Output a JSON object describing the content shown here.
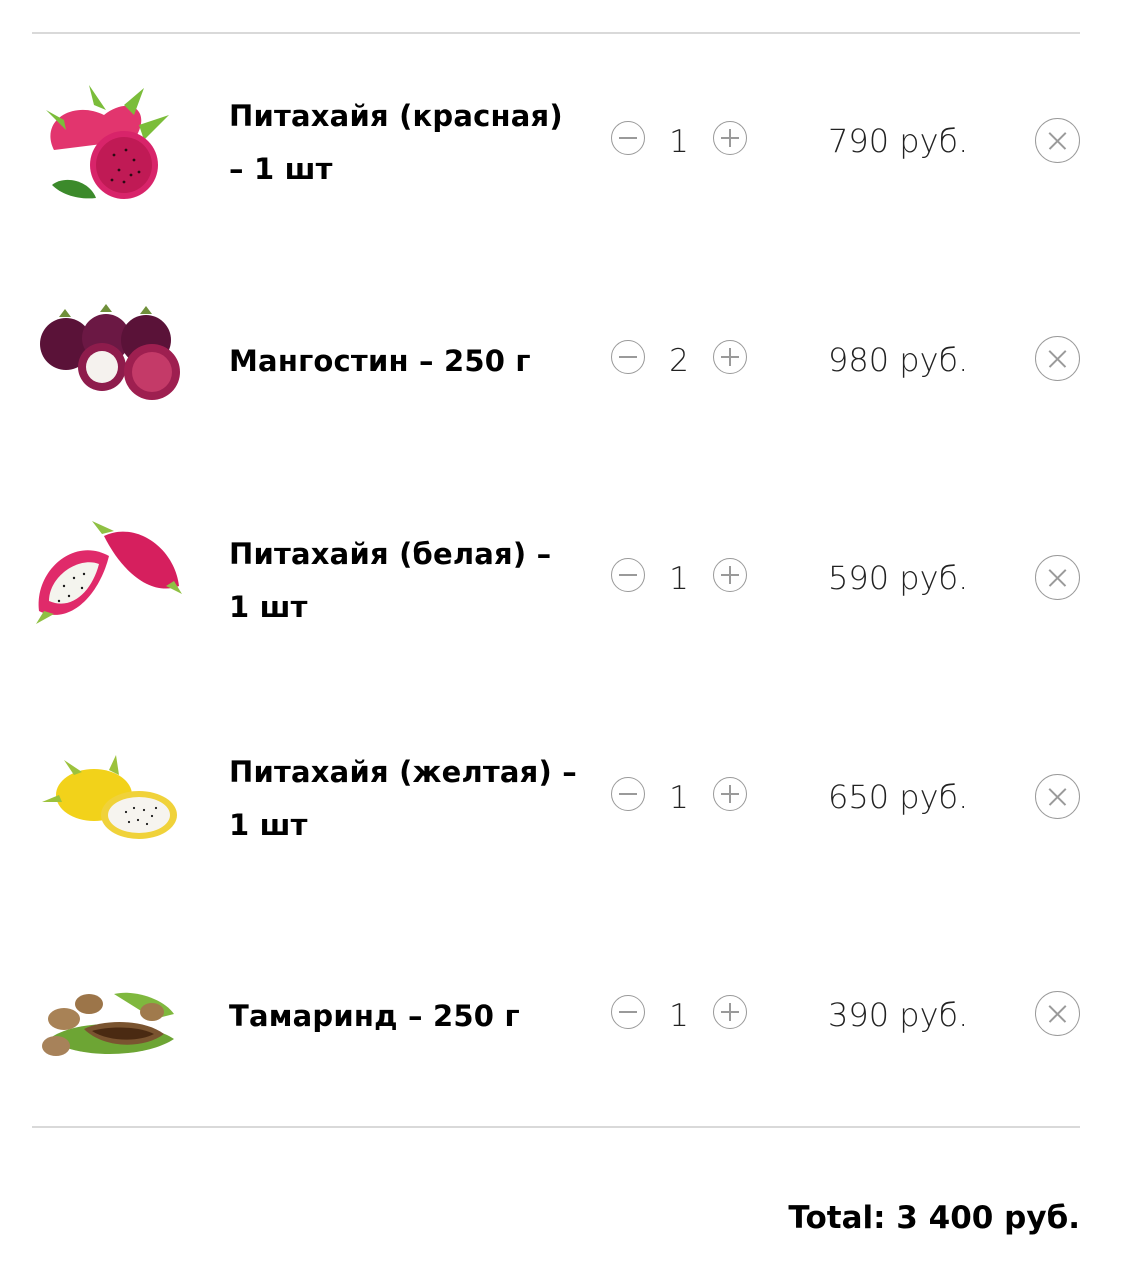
{
  "cart": {
    "items": [
      {
        "title": "Питахайя (красная) – 1 шт",
        "quantity": "1",
        "price": "790 руб.",
        "image": "red-dragon-fruit"
      },
      {
        "title": "Мангостин – 250 г",
        "quantity": "2",
        "price": "980 руб.",
        "image": "mangosteen"
      },
      {
        "title": "Питахайя (белая) – 1 шт",
        "quantity": "1",
        "price": "590 руб.",
        "image": "white-dragon-fruit"
      },
      {
        "title": "Питахайя (желтая) – 1 шт",
        "quantity": "1",
        "price": "650 руб.",
        "image": "yellow-dragon-fruit"
      },
      {
        "title": "Тамаринд – 250 г",
        "quantity": "1",
        "price": "390 руб.",
        "image": "tamarind"
      }
    ],
    "total_label": "Total: 3 400 руб."
  },
  "icons": {
    "decrease": "minus-circle-icon",
    "increase": "plus-circle-icon",
    "remove": "close-circle-icon"
  },
  "colors": {
    "divider": "#d9d9d9",
    "icon_stroke": "#9a9a9a",
    "text": "#000000"
  }
}
